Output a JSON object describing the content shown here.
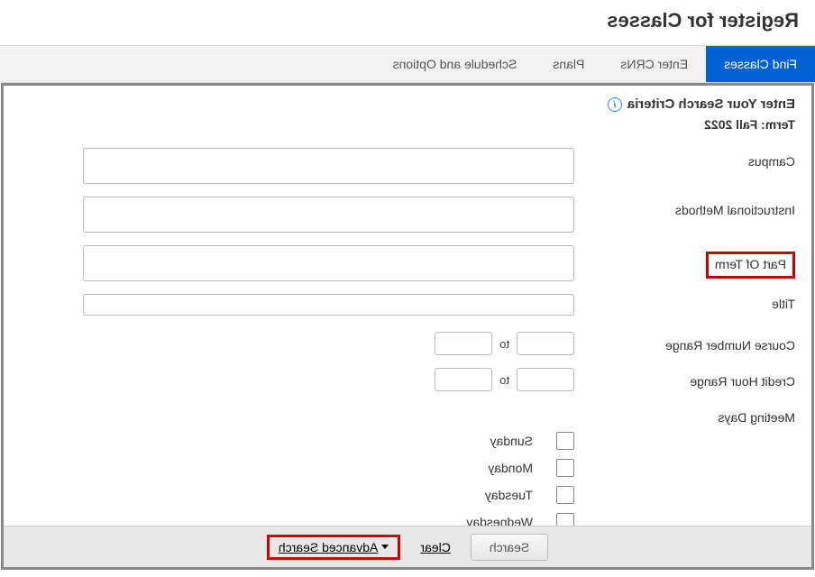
{
  "page_title": "Register for Classes",
  "tabs": [
    {
      "label": "Find Classes",
      "active": true
    },
    {
      "label": "Enter CRNs",
      "active": false
    },
    {
      "label": "Plans",
      "active": false
    },
    {
      "label": "Schedule and Options",
      "active": false
    }
  ],
  "criteria_heading": "Enter Your Search Criteria",
  "term_prefix": "Term:",
  "term_value": "Fall 2022",
  "labels": {
    "campus": "Campus",
    "instructional_methods": "Instructional Methods",
    "part_of_term": "Part Of Term",
    "title": "Title",
    "course_number_range": "Course Number Range",
    "credit_hour_range": "Credit Hour Range",
    "meeting_days": "Meeting Days"
  },
  "range_sep": "to",
  "days": [
    "Sunday",
    "Monday",
    "Tuesday",
    "Wednesday"
  ],
  "buttons": {
    "search": "Search",
    "clear": "Clear",
    "advanced": "Advanced Search"
  }
}
